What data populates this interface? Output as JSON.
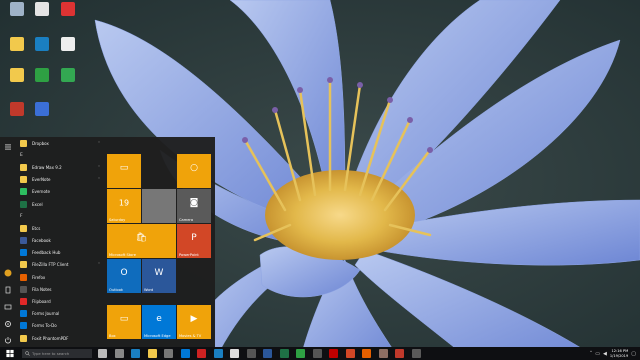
{
  "desktop": {
    "icons": [
      {
        "name": "Recycle Bin",
        "color": "#9fb3c8"
      },
      {
        "name": "Google Chrome",
        "color": "#e4e4e4"
      },
      {
        "name": "WinZip",
        "color": "#d33"
      },
      {
        "name": "folder",
        "color": "#f2c94c"
      },
      {
        "name": "Explorer",
        "color": "#1a7fc1"
      },
      {
        "name": "document",
        "color": "#eee"
      },
      {
        "name": "folder",
        "color": "#f2c94c"
      },
      {
        "name": "Xbox",
        "color": "#2ea043"
      },
      {
        "name": "Cast",
        "color": "#33a852"
      },
      {
        "name": "Adobe",
        "color": "#c0392b"
      },
      {
        "name": "Inter",
        "color": "#3b6fd6"
      }
    ]
  },
  "start_menu": {
    "rail_icons": [
      "hamburger-icon",
      "user-icon",
      "documents-icon",
      "pictures-icon",
      "settings-icon",
      "power-icon"
    ],
    "apps": [
      {
        "label": "Dropbox",
        "type": "folder",
        "color": "#f2c94c",
        "chevron": "˅"
      },
      {
        "label": "E",
        "type": "letter"
      },
      {
        "label": "Edraw Max 9.2",
        "type": "folder",
        "color": "#f2c94c",
        "chevron": "˅"
      },
      {
        "label": "EverNote",
        "type": "folder",
        "color": "#f2c94c",
        "chevron": "˅"
      },
      {
        "label": "Evernote",
        "type": "app",
        "color": "#2dbe60"
      },
      {
        "label": "Excel",
        "type": "app",
        "color": "#1e7145"
      },
      {
        "label": "F",
        "type": "letter"
      },
      {
        "label": "Etcs",
        "type": "folder",
        "color": "#f2c94c"
      },
      {
        "label": "Facebook",
        "type": "app",
        "color": "#3b5998"
      },
      {
        "label": "Feedback Hub",
        "type": "app",
        "color": "#0078d7"
      },
      {
        "label": "FileZilla FTP Client",
        "type": "folder",
        "color": "#f2c94c",
        "chevron": "˅"
      },
      {
        "label": "Firefox",
        "type": "app",
        "color": "#e66000"
      },
      {
        "label": "Fila Notes",
        "type": "app",
        "color": "#555"
      },
      {
        "label": "Flipboard",
        "type": "app",
        "color": "#e12828"
      },
      {
        "label": "Forms Journal",
        "type": "app",
        "color": "#0078d7"
      },
      {
        "label": "Forms To-Do",
        "type": "app",
        "color": "#0078d7"
      },
      {
        "label": "Foxit PhantomPDF",
        "type": "folder",
        "color": "#f2c94c"
      }
    ],
    "tiles": [
      {
        "label": "",
        "color": "#f0a30a",
        "glyph": "▭"
      },
      {
        "label": "Saturday",
        "sub": "19",
        "color": "#f0a30a"
      },
      {
        "label": "",
        "color": "#777",
        "glyph": ""
      },
      {
        "label": "Camera",
        "color": "#5a5a5a",
        "glyph": "◙"
      },
      {
        "label": "",
        "color": "#f0a30a",
        "glyph": "○"
      },
      {
        "label": "Microsoft Store",
        "color": "#f0a30a",
        "glyph": "🛍"
      },
      {
        "label": "PowerPoint",
        "color": "#d24726",
        "glyph": "P"
      },
      {
        "label": "Outlook",
        "color": "#0f6cbd",
        "glyph": "O"
      },
      {
        "label": "Word",
        "color": "#2b579a",
        "glyph": "W"
      },
      {
        "label": "Box",
        "color": "#f0a30a",
        "glyph": "▭"
      },
      {
        "label": "Microsoft Edge",
        "color": "#0078d7",
        "glyph": "e"
      },
      {
        "label": "Movies & TV",
        "color": "#f0a30a",
        "glyph": "▶"
      }
    ]
  },
  "taskbar": {
    "search_placeholder": "Type here to search",
    "pinned": [
      {
        "name": "cortana",
        "color": "#bbbbbb"
      },
      {
        "name": "task-view",
        "color": "#888"
      },
      {
        "name": "edge",
        "color": "#1a7fc1"
      },
      {
        "name": "file-explorer",
        "color": "#f2c94c"
      },
      {
        "name": "store",
        "color": "#777"
      },
      {
        "name": "mail",
        "color": "#0078d7"
      },
      {
        "name": "x-app",
        "color": "#cc2222"
      },
      {
        "name": "photos",
        "color": "#1a7fc1"
      },
      {
        "name": "chrome",
        "color": "#ddd"
      },
      {
        "name": "calc",
        "color": "#555"
      },
      {
        "name": "word",
        "color": "#2b579a"
      },
      {
        "name": "excel",
        "color": "#1e7145"
      },
      {
        "name": "xbox",
        "color": "#2ea043"
      },
      {
        "name": "app",
        "color": "#555"
      },
      {
        "name": "filezilla",
        "color": "#bf0000"
      },
      {
        "name": "app2",
        "color": "#d24726"
      },
      {
        "name": "firefox",
        "color": "#e66000"
      },
      {
        "name": "app3",
        "color": "#8d6e63"
      },
      {
        "name": "app4",
        "color": "#c0392b"
      },
      {
        "name": "app5",
        "color": "#5a5a5a"
      }
    ],
    "clock_time": "12:16 PM",
    "clock_date": "1/19/2019"
  }
}
